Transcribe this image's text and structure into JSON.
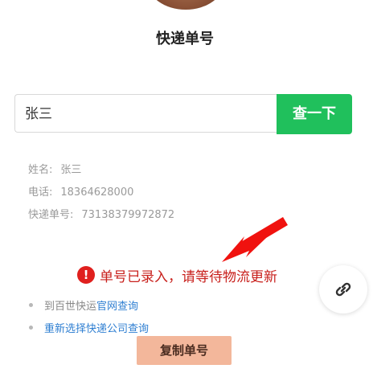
{
  "header": {
    "title": "快递单号"
  },
  "search": {
    "value": "张三",
    "button_label": "查一下"
  },
  "info": {
    "name_label": "姓名:",
    "name_value": "张三",
    "phone_label": "电话:",
    "phone_value": "18364628000",
    "tracking_label": "快递单号:",
    "tracking_value": "73138379972872"
  },
  "status": {
    "icon": "!",
    "message": "单号已录入，请等待物流更新"
  },
  "links": {
    "row1_prefix": "到百世快运",
    "row1_link": "官网查询",
    "row2_link": "重新选择快递公司查询"
  },
  "actions": {
    "copy_label": "复制单号"
  },
  "colors": {
    "accent_green": "#20c05c",
    "status_red": "#c8201c",
    "link_blue": "#2f7fd2",
    "copy_button": "#f3b79b"
  },
  "icons": {
    "floating": "link-icon",
    "status": "alert-icon",
    "annotation": "red-arrow"
  }
}
